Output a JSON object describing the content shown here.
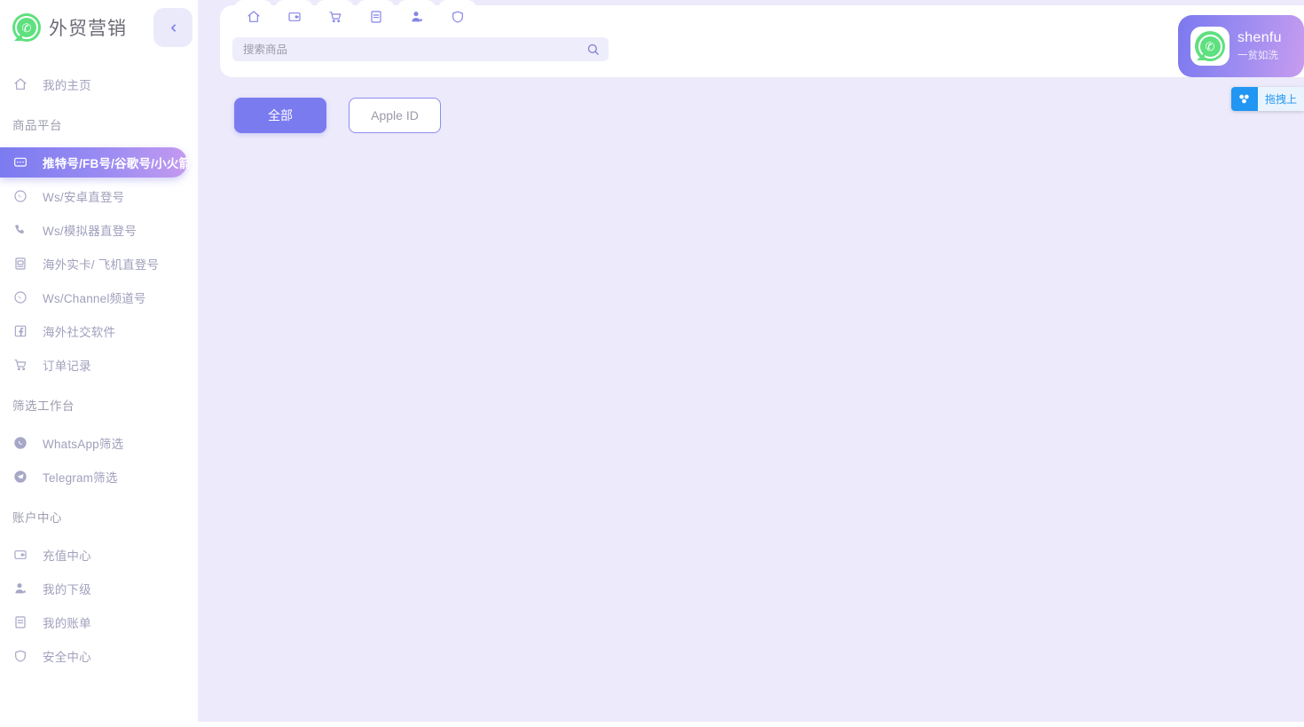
{
  "brand": {
    "title": "外贸营销",
    "logo_icon": "whatsapp-logo-icon",
    "collapse_icon": "chevron-left-icon"
  },
  "sidebar": {
    "home": {
      "label": "我的主页",
      "icon": "home-icon"
    },
    "groups": [
      {
        "title": "商品平台",
        "items": [
          {
            "label": "推特号/FB号/谷歌号/小火箭",
            "icon": "message-icon",
            "active": true
          },
          {
            "label": "Ws/安卓直登号",
            "icon": "whatsapp-icon",
            "active": false
          },
          {
            "label": "Ws/模拟器直登号",
            "icon": "phone-icon",
            "active": false
          },
          {
            "label": "海外实卡/ 飞机直登号",
            "icon": "card-icon",
            "active": false
          },
          {
            "label": "Ws/Channel频道号",
            "icon": "whatsapp-icon",
            "active": false
          },
          {
            "label": "海外社交软件",
            "icon": "facebook-icon",
            "active": false
          },
          {
            "label": "订单记录",
            "icon": "cart-icon",
            "active": false
          }
        ]
      },
      {
        "title": "筛选工作台",
        "items": [
          {
            "label": "WhatsApp筛选",
            "icon": "whatsapp-filled-icon",
            "active": false
          },
          {
            "label": "Telegram筛选",
            "icon": "telegram-filled-icon",
            "active": false
          }
        ]
      },
      {
        "title": "账户中心",
        "items": [
          {
            "label": "充值中心",
            "icon": "wallet-icon",
            "active": false
          },
          {
            "label": "我的下级",
            "icon": "user-plus-icon",
            "active": false
          },
          {
            "label": "我的账单",
            "icon": "bill-icon",
            "active": false
          },
          {
            "label": "安全中心",
            "icon": "shield-icon",
            "active": false
          }
        ]
      }
    ]
  },
  "header": {
    "tabs": [
      {
        "icon": "home-icon",
        "name": "home"
      },
      {
        "icon": "wallet-icon",
        "name": "recharge"
      },
      {
        "icon": "cart-icon",
        "name": "orders"
      },
      {
        "icon": "bill-icon",
        "name": "bills"
      },
      {
        "icon": "user-plus-icon",
        "name": "subordinates"
      },
      {
        "icon": "shield-icon",
        "name": "security"
      }
    ],
    "search": {
      "value": "",
      "placeholder": "搜索商品",
      "icon": "search-icon"
    },
    "account": {
      "name": "shenfu",
      "subtitle": "一贫如洗",
      "avatar_icon": "whatsapp-logo-icon"
    }
  },
  "main": {
    "filters": [
      {
        "label": "全部",
        "active": true
      },
      {
        "label": "Apple ID",
        "active": false
      }
    ]
  },
  "netdisk_widget": {
    "label": "拖拽上",
    "icon": "baidu-netdisk-icon"
  },
  "colors": {
    "accent": "#7b7bf0",
    "accent_gradient_end": "#c39af0",
    "page_bg": "#eceafb",
    "sidebar_bg": "#ffffff",
    "muted_text": "#a0a0bd",
    "netdisk_blue": "#2196f3",
    "logo_green": "#5fe07f"
  }
}
